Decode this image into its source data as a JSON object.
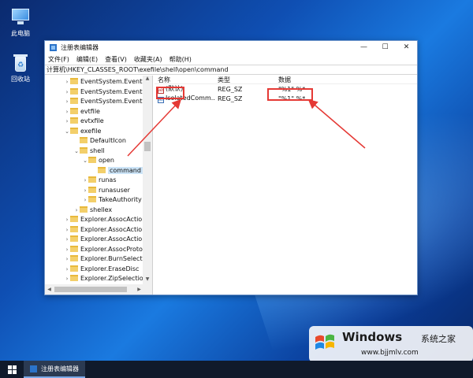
{
  "desktop": {
    "icons": [
      {
        "label": "此电脑"
      },
      {
        "label": "回收站"
      }
    ]
  },
  "window": {
    "title": "注册表编辑器",
    "controls": {
      "minimize": "—",
      "maximize": "☐",
      "close": "✕"
    },
    "menu": [
      "文件(F)",
      "编辑(E)",
      "查看(V)",
      "收藏夹(A)",
      "帮助(H)"
    ],
    "address": "计算机\\HKEY_CLASSES_ROOT\\exefile\\shell\\open\\command",
    "tree": [
      {
        "label": "EventSystem.EventSul",
        "chev": "›"
      },
      {
        "label": "EventSystem.EventSys",
        "chev": "›"
      },
      {
        "label": "EventSystem.EventSys",
        "chev": "›"
      },
      {
        "label": "evtfile",
        "chev": "›"
      },
      {
        "label": "evtxfile",
        "chev": "›"
      },
      {
        "label": "exefile",
        "chev": "⌄"
      },
      {
        "label": "DefaultIcon",
        "chev": ""
      },
      {
        "label": "shell",
        "chev": "⌄"
      },
      {
        "label": "open",
        "chev": "⌄"
      },
      {
        "label": "command",
        "chev": ""
      },
      {
        "label": "runas",
        "chev": "›"
      },
      {
        "label": "runasuser",
        "chev": "›"
      },
      {
        "label": "TakeAuthority",
        "chev": "›"
      },
      {
        "label": "shellex",
        "chev": "›"
      },
      {
        "label": "Explorer.AssocAction",
        "chev": "›"
      },
      {
        "label": "Explorer.AssocAction",
        "chev": "›"
      },
      {
        "label": "Explorer.AssocAction",
        "chev": "›"
      },
      {
        "label": "Explorer.AssocProtoc",
        "chev": "›"
      },
      {
        "label": "Explorer.BurnSelection",
        "chev": "›"
      },
      {
        "label": "Explorer.EraseDisc",
        "chev": "›"
      },
      {
        "label": "Explorer.ZipSelection",
        "chev": "›"
      }
    ],
    "list": {
      "headers": [
        "名称",
        "类型",
        "数据"
      ],
      "rows": [
        {
          "name": "(默认)",
          "type": "REG_SZ",
          "data": "\"%1\" %*"
        },
        {
          "name": "IsolatedComm...",
          "type": "REG_SZ",
          "data": "\"%1\" %*"
        }
      ]
    }
  },
  "taskbar": {
    "task_label": "注册表编辑器"
  },
  "watermark": {
    "brand": "Windows",
    "zh": "系统之家",
    "url": "www.bjjmlv.com"
  },
  "colors": {
    "annotation": "#e53935",
    "accent": "#2b73c9"
  }
}
